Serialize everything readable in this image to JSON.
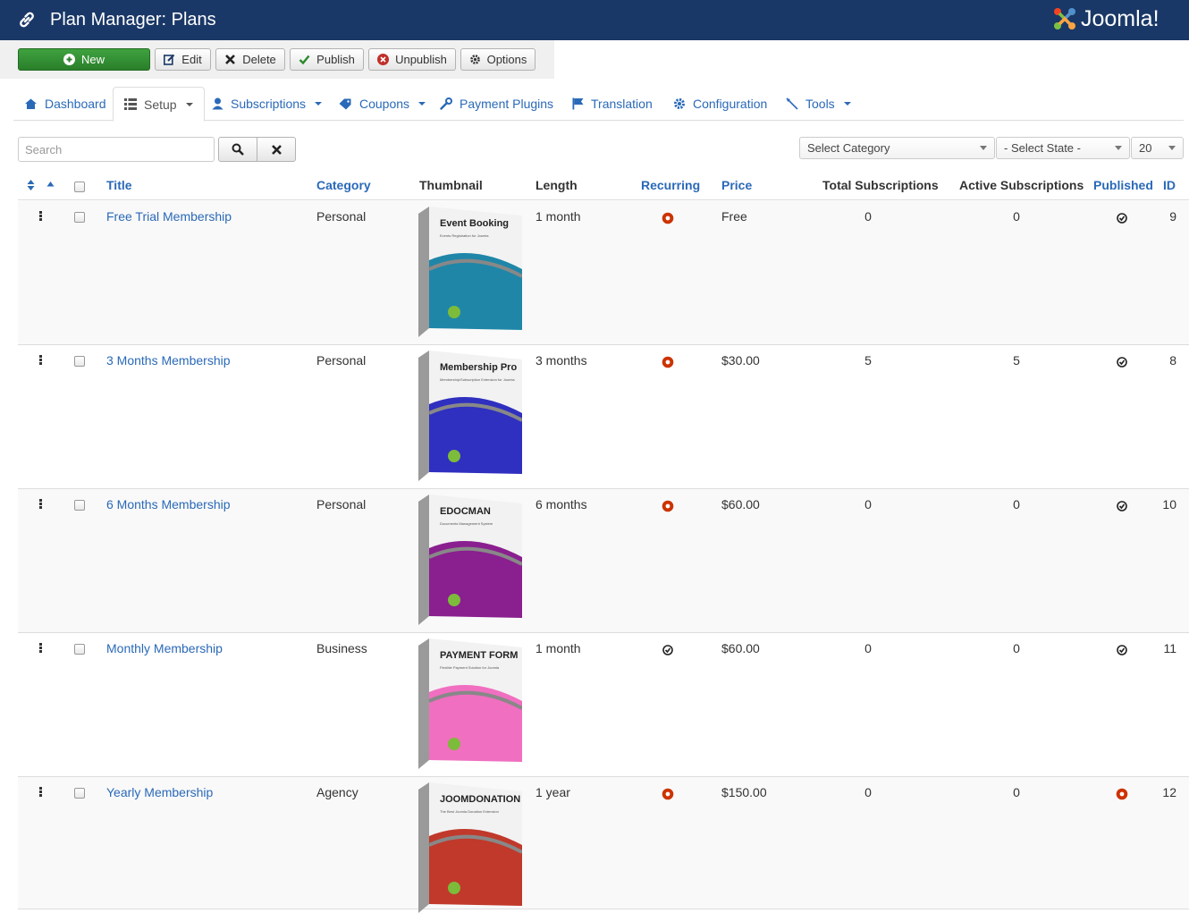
{
  "header": {
    "title": "Plan Manager: Plans",
    "brand": "Joomla!"
  },
  "toolbar": {
    "new_label": "New",
    "edit_label": "Edit",
    "delete_label": "Delete",
    "publish_label": "Publish",
    "unpublish_label": "Unpublish",
    "options_label": "Options"
  },
  "tabs": [
    {
      "label": "Dashboard",
      "icon": "home-icon"
    },
    {
      "label": "Setup",
      "icon": "list-icon"
    },
    {
      "label": "Subscriptions",
      "icon": "user-icon"
    },
    {
      "label": "Coupons",
      "icon": "tag-icon"
    },
    {
      "label": "Payment Plugins",
      "icon": "wrench-icon"
    },
    {
      "label": "Translation",
      "icon": "flag-icon"
    },
    {
      "label": "Configuration",
      "icon": "gear-icon"
    },
    {
      "label": "Tools",
      "icon": "pin-icon"
    }
  ],
  "filters": {
    "search_placeholder": "Search",
    "category": "Select Category",
    "state": "- Select State -",
    "limit": "20"
  },
  "columns": {
    "title": "Title",
    "category": "Category",
    "thumbnail": "Thumbnail",
    "length": "Length",
    "recurring": "Recurring",
    "price": "Price",
    "total_subscriptions": "Total Subscriptions",
    "active_subscriptions": "Active Subscriptions",
    "published": "Published",
    "id": "ID"
  },
  "rows": [
    {
      "title": "Free Trial Membership",
      "category": "Personal",
      "thumbnail": {
        "product": "Event Booking",
        "subtitle": "Events Registration for Joomla",
        "color": "#1f86a8"
      },
      "length": "1 month",
      "recurring": "no",
      "price": "Free",
      "total": "0",
      "active": "0",
      "published": "yes",
      "id": "9"
    },
    {
      "title": "3 Months Membership",
      "category": "Personal",
      "thumbnail": {
        "product": "Membership Pro",
        "subtitle": "Membership/Subscription Extension for Joomla",
        "color": "#2f2fc0"
      },
      "length": "3 months",
      "recurring": "no",
      "price": "$30.00",
      "total": "5",
      "active": "5",
      "published": "yes",
      "id": "8"
    },
    {
      "title": "6 Months Membership",
      "category": "Personal",
      "thumbnail": {
        "product": "EDOCMAN",
        "subtitle": "Documents Management System",
        "color": "#8a1f8f"
      },
      "length": "6 months",
      "recurring": "no",
      "price": "$60.00",
      "total": "0",
      "active": "0",
      "published": "yes",
      "id": "10"
    },
    {
      "title": "Monthly Membership",
      "category": "Business",
      "thumbnail": {
        "product": "PAYMENT FORM",
        "subtitle": "Flexible Payment Solution for Joomla",
        "color": "#f06fc0"
      },
      "length": "1 month",
      "recurring": "yes",
      "price": "$60.00",
      "total": "0",
      "active": "0",
      "published": "yes",
      "id": "11"
    },
    {
      "title": "Yearly Membership",
      "category": "Agency",
      "thumbnail": {
        "product": "JOOMDONATION",
        "subtitle": "The Best Joomla Donation Extension",
        "color": "#c0392b"
      },
      "length": "1 year",
      "recurring": "no",
      "price": "$150.00",
      "total": "0",
      "active": "0",
      "published": "no",
      "id": "12"
    }
  ],
  "colors": {
    "header_bg": "#1a3867",
    "link": "#2a69b8",
    "new_button": "#2f8f2f",
    "unpublished": "#cc3300"
  }
}
